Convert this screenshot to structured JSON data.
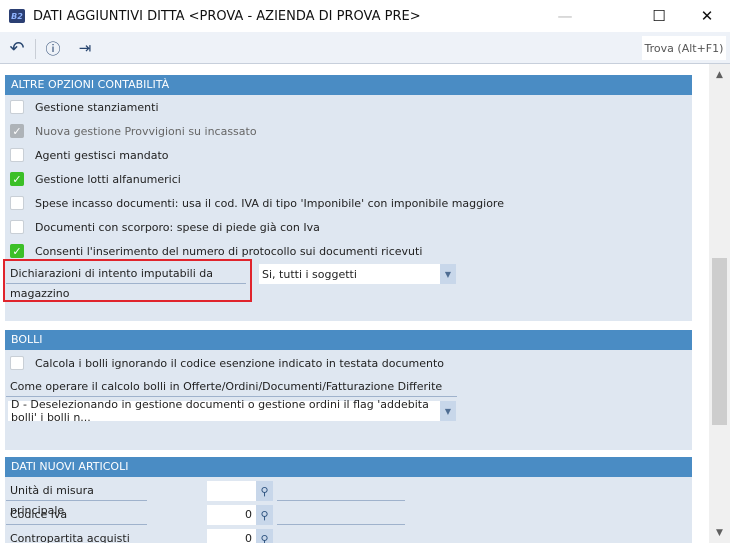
{
  "window": {
    "title": "DATI AGGIUNTIVI DITTA <PROVA - AZIENDA DI PROVA PRE>",
    "app_icon": "B2"
  },
  "toolbar": {
    "search_label": "Trova (Alt+F1)"
  },
  "section1": {
    "title": "ALTRE OPZIONI CONTABILITÀ",
    "checkboxes": [
      {
        "label": "Gestione stanziamenti",
        "checked": false
      },
      {
        "label": "Nuova gestione Provvigioni su incassato",
        "checked": true,
        "disabled": true
      },
      {
        "label": "Agenti gestisci mandato",
        "checked": false
      },
      {
        "label": "Gestione lotti alfanumerici",
        "checked": true
      },
      {
        "label": "Spese incasso documenti: usa il cod. IVA di tipo 'Imponibile' con imponibile maggiore",
        "checked": false
      },
      {
        "label": "Documenti con scorporo: spese di piede già con Iva",
        "checked": false
      },
      {
        "label": "Consenti l'inserimento del numero di protocollo sui documenti ricevuti",
        "checked": true
      }
    ],
    "field_label": "Dichiarazioni di intento imputabili da magazzino",
    "field_value": "Si, tutti i soggetti"
  },
  "section2": {
    "title": "BOLLI",
    "checkbox": {
      "label": "Calcola i bolli ignorando il codice esenzione indicato in testata documento",
      "checked": false
    },
    "field_label": "Come operare il calcolo bolli in Offerte/Ordini/Documenti/Fatturazione Differite",
    "field_value": "D - Deselezionando in gestione documenti o gestione ordini il flag 'addebita bolli' i bolli n..."
  },
  "section3": {
    "title": "DATI NUOVI ARTICOLI",
    "fields": [
      {
        "label": "Unità di misura principale",
        "value": ""
      },
      {
        "label": "Codice iva",
        "value": "0"
      },
      {
        "label": "Contropartita acquisti",
        "value": "0"
      }
    ]
  },
  "colors": {
    "header": "#4a8cc4",
    "section_bg": "#dfe7f1",
    "check": "#3bbf27",
    "highlight": "#e0242c"
  }
}
